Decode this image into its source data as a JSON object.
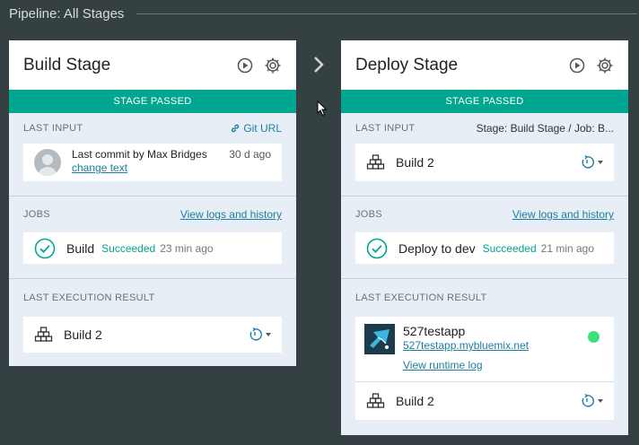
{
  "pipeline": {
    "title": "Pipeline: All Stages"
  },
  "build_stage": {
    "name": "Build Stage",
    "status": "STAGE PASSED",
    "last_input": {
      "label": "LAST INPUT",
      "link": "Git URL",
      "commit_message": "Last commit by Max Bridges",
      "commit_link": "change text",
      "commit_age": "30 d ago"
    },
    "jobs": {
      "label": "JOBS",
      "link": "View logs and history",
      "items": [
        {
          "name": "Build",
          "status": "Succeeded",
          "time": "23 min ago"
        }
      ]
    },
    "result": {
      "label": "LAST EXECUTION RESULT",
      "build": "Build 2"
    }
  },
  "deploy_stage": {
    "name": "Deploy Stage",
    "status": "STAGE PASSED",
    "last_input": {
      "label": "LAST INPUT",
      "meta": "Stage: Build Stage  /  Job: B...",
      "build": "Build 2"
    },
    "jobs": {
      "label": "JOBS",
      "link": "View logs and history",
      "items": [
        {
          "name": "Deploy to dev",
          "status": "Succeeded",
          "time": "21 min ago"
        }
      ]
    },
    "result": {
      "label": "LAST EXECUTION RESULT",
      "app_name": "527testapp",
      "app_url": "527testapp.mybluemix.net",
      "runtime_log": "View runtime log",
      "build": "Build 2"
    }
  },
  "colors": {
    "accent": "#00a68f",
    "link": "#1a7fa0",
    "background": "#354042",
    "running": "#3fe07a"
  }
}
